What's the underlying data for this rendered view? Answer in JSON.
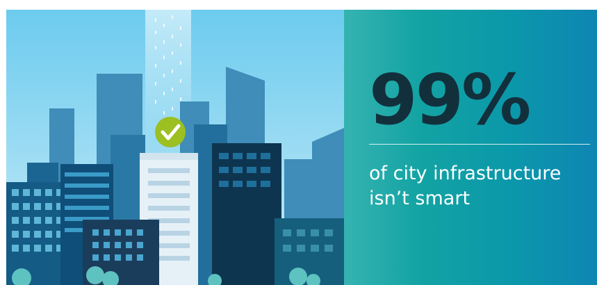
{
  "headline": {
    "stat": "99%",
    "line1": "of city infrastructure",
    "line2": "isn’t smart"
  },
  "icons": {
    "badge": "check-badge-icon"
  },
  "colors": {
    "sky_top": "#6ccbee",
    "sky_bottom": "#c9ecf8",
    "panel_start": "#35b3b1",
    "panel_end": "#0e86b3",
    "stat_text": "#12303c",
    "badge": "#9cbf22"
  }
}
